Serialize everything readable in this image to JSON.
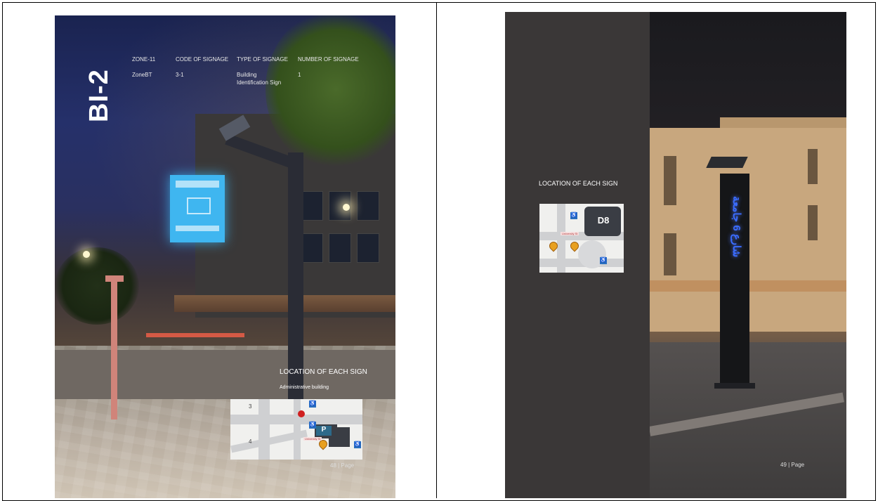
{
  "left_page": {
    "code_title": "BI-2",
    "meta": {
      "headers": [
        "ZONE-11",
        "CODE OF SIGNAGE",
        "TYPE OF SIGNAGE",
        "NUMBER OF SIGNAGE"
      ],
      "values": [
        "ZoneBT",
        "3-1",
        "Building Identification Sign",
        "1"
      ]
    },
    "location_title": "LOCATION OF EACH SIGN",
    "location_sub": "Administrative building",
    "map": {
      "building_tag": "P",
      "road_label": "University St",
      "numbers": [
        "3",
        "4"
      ]
    },
    "page_number": "48 | Page"
  },
  "right_page": {
    "location_title": "LOCATION OF EACH SIGN",
    "map": {
      "building_tag": "D8",
      "road_label": "University St"
    },
    "totem_text": "شارع 6 جامعة",
    "page_number": "49 | Page"
  },
  "colors": {
    "lightbox": "#3fb6f0",
    "right_panel": "#3a3737",
    "pin": "#e8a020",
    "accessible": "#2a6fc0",
    "totem_led": "#3a6cff"
  }
}
